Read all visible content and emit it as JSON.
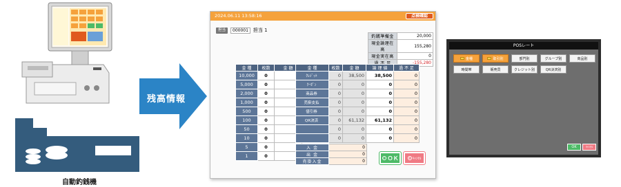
{
  "hardware": {
    "caption": "自動釣銭機"
  },
  "arrow": {
    "label": "残高情報"
  },
  "main": {
    "timestamp": "2024.06.11 13:58:16",
    "inspection_button": "点検確認",
    "staff_tag": "担当",
    "staff_code": "000001",
    "staff_name": "担当 1",
    "summary": [
      {
        "label": "釣銭準備金",
        "value": "20,000"
      },
      {
        "label": "現金論理在高",
        "value": "155,280"
      },
      {
        "label": "現金実在高",
        "value": "0"
      },
      {
        "label": "過 不 足",
        "value": "-155,280"
      }
    ],
    "denom_headers": [
      "金 種",
      "枚数",
      "金 額"
    ],
    "denominations": [
      {
        "d": "10,000",
        "c": "0",
        "a": "0"
      },
      {
        "d": "5,000",
        "c": "0",
        "a": "0"
      },
      {
        "d": "2,000",
        "c": "0",
        "a": "0"
      },
      {
        "d": "1,000",
        "c": "0",
        "a": "0"
      },
      {
        "d": "500",
        "c": "0",
        "a": "0"
      },
      {
        "d": "100",
        "c": "0",
        "a": "0"
      },
      {
        "d": "50",
        "c": "0",
        "a": "0"
      },
      {
        "d": "10",
        "c": "0",
        "a": "0"
      },
      {
        "d": "5",
        "c": "0",
        "a": "0"
      },
      {
        "d": "1",
        "c": "0",
        "a": "0"
      }
    ],
    "pay_headers": [
      "金 種",
      "枚数",
      "金 額",
      "論 理 値",
      "過 不 足"
    ],
    "payments": [
      {
        "l": "ｸﾚｼﾞｯﾄ",
        "n": "0",
        "k": "38,500",
        "r": "38,500",
        "s": "0"
      },
      {
        "l": "ｸｰﾎﾟﾝ",
        "n": "0",
        "k": "0",
        "r": "0",
        "s": "0"
      },
      {
        "l": "商品券",
        "n": "0",
        "k": "0",
        "r": "0",
        "s": "0"
      },
      {
        "l": "売掛支払",
        "n": "0",
        "k": "0",
        "r": "0",
        "s": "0"
      },
      {
        "l": "値引券",
        "n": "0",
        "k": "0",
        "r": "0",
        "s": "0"
      },
      {
        "l": "QR決済",
        "n": "0",
        "k": "61,132",
        "r": "61,132",
        "s": "0"
      },
      {
        "l": "",
        "n": "0",
        "k": "0",
        "r": "0",
        "s": "0"
      },
      {
        "l": "",
        "n": "0",
        "k": "0",
        "r": "0",
        "s": "0"
      }
    ],
    "inout": [
      {
        "label": "入 金",
        "value": "0"
      },
      {
        "label": "出 金",
        "value": "0"
      },
      {
        "label": "売掛入金",
        "value": "0"
      }
    ],
    "ok_label": "ＯＫ",
    "cancel_label": "ｷｬﾝｾﾙ"
  },
  "pos": {
    "title": "POSレート",
    "buttons": [
      {
        "label": "金種",
        "selected": true,
        "icon": true
      },
      {
        "label": "取引別",
        "selected": true,
        "icon": true
      },
      {
        "label": "部門別",
        "selected": false
      },
      {
        "label": "グループ別",
        "selected": false
      },
      {
        "label": "商品別",
        "selected": false
      },
      {
        "label": "時間帯",
        "selected": false
      },
      {
        "label": "販売员",
        "selected": false
      },
      {
        "label": "クレジット別",
        "selected": false
      },
      {
        "label": "QR決済別",
        "selected": false
      }
    ],
    "ok_label": "OK",
    "cancel_label": "ｷｬﾝｾﾙ"
  }
}
